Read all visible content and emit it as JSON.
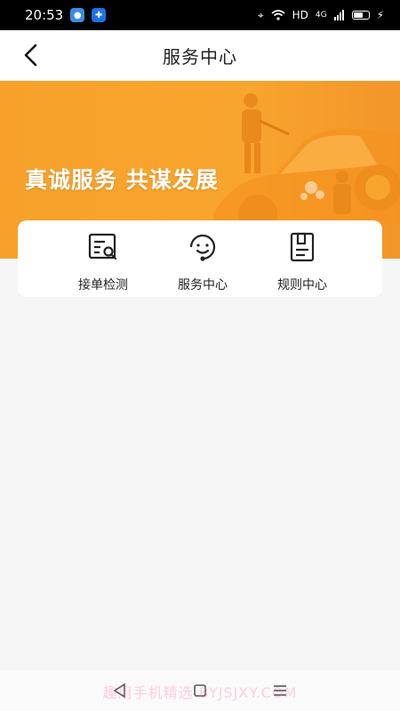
{
  "status_bar": {
    "time": "20:53",
    "network": "HD",
    "signal_label": "4G"
  },
  "nav": {
    "title": "服务中心"
  },
  "banner": {
    "slogan": "真诚服务 共谋发展"
  },
  "menu": [
    {
      "label": "接单检测",
      "icon": "document-search-icon"
    },
    {
      "label": "服务中心",
      "icon": "customer-service-icon"
    },
    {
      "label": "规则中心",
      "icon": "rulebook-icon"
    }
  ],
  "watermark": "趣用手机精选 BYJSJXY.COM",
  "colors": {
    "banner": "#f7a12a",
    "background": "#f6f6f6",
    "card": "#ffffff"
  }
}
